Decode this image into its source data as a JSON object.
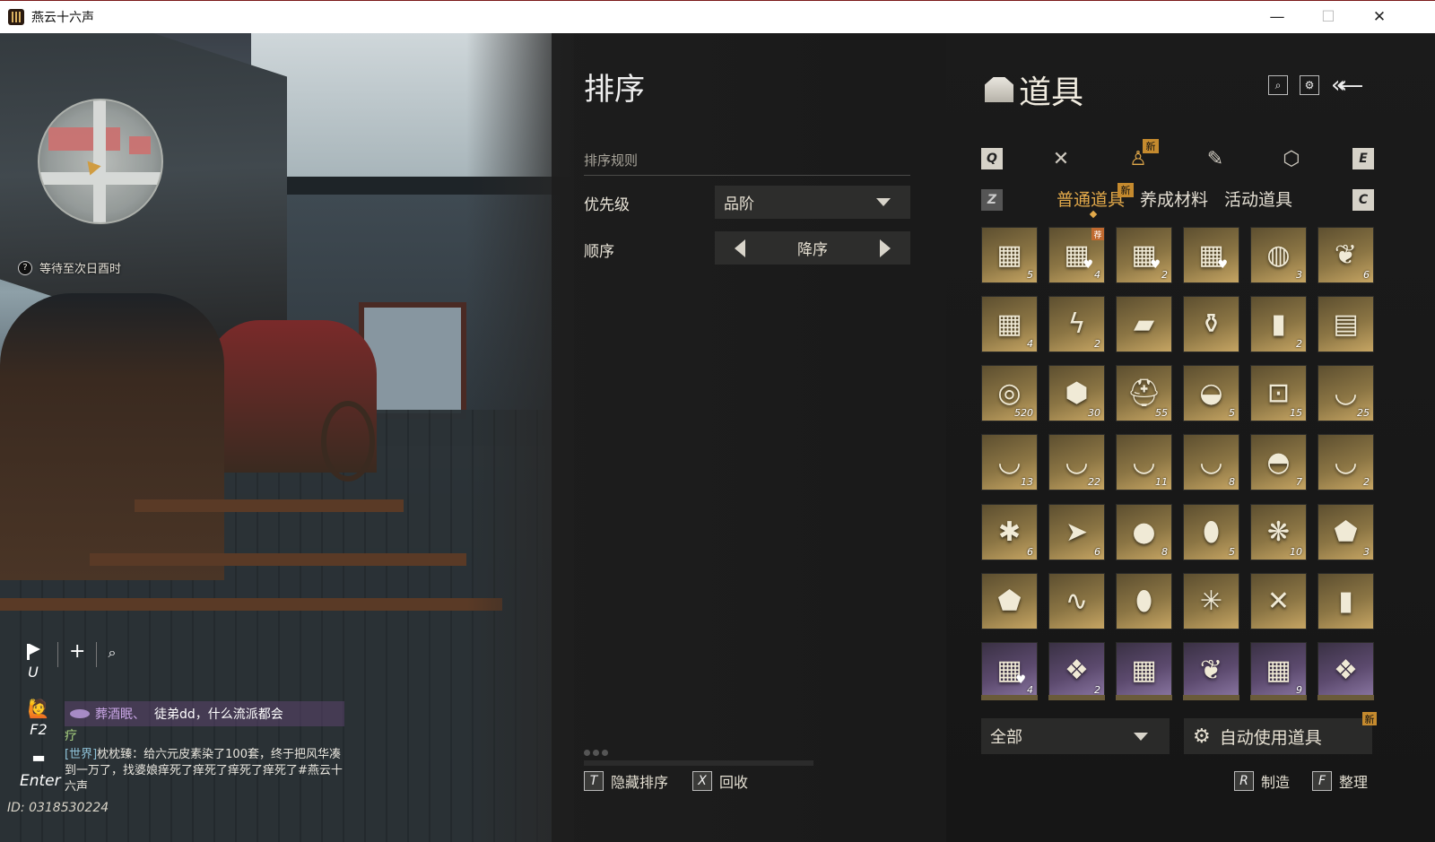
{
  "window": {
    "title": "燕云十六声",
    "controls": {
      "minimize": "—",
      "maximize": "☐",
      "close": "✕"
    }
  },
  "hud": {
    "wait_text": "等待至次日酉时",
    "wait_icon_glyph": "?",
    "map_key": "U",
    "add_glyph": "+",
    "search_glyph": "⌕",
    "chat": {
      "emote_key": "F2",
      "chat_key": "Enter",
      "msg1_name": "葬酒眠、",
      "msg1_text": "徒弟dd，什么流派都会",
      "msg1_cont": "疗",
      "world_tag": "[世界]",
      "world_text": "枕枕臻：给六元皮素染了100套，终于把风华凑到一万了，找婆娘痒死了痒死了痒死了痒死了#燕云十六声"
    },
    "id_text": "ID: 0318530224"
  },
  "sort": {
    "title": "排序",
    "rule_header": "排序规则",
    "priority_label": "优先级",
    "priority_value": "品阶",
    "order_label": "顺序",
    "order_value": "降序",
    "hint_hide_key": "T",
    "hint_hide": "隐藏排序",
    "hint_recycle_key": "X",
    "hint_recycle": "回收"
  },
  "inventory": {
    "title": "道具",
    "key_left": "Q",
    "key_right": "E",
    "sub_key_left": "Z",
    "sub_key_right": "C",
    "new_badge": "新",
    "subtabs": [
      "普通道具",
      "养成材料",
      "活动道具"
    ],
    "active_subtab": 0,
    "category_icons": [
      "crossed-swords-icon",
      "bell-icon",
      "scroll-icon",
      "badge-icon"
    ],
    "active_category": 1,
    "items": [
      {
        "name": "chest",
        "glyph": "▦",
        "count": "5",
        "tone": "gold"
      },
      {
        "name": "chest-heart-tagged",
        "glyph": "▦",
        "count": "4",
        "tone": "gold",
        "heart": true,
        "tag": "荐"
      },
      {
        "name": "chest-heart",
        "glyph": "▦",
        "count": "2",
        "tone": "gold",
        "heart": true
      },
      {
        "name": "chest-heart",
        "glyph": "▦",
        "count": "",
        "tone": "gold",
        "heart": true
      },
      {
        "name": "shell-chest",
        "glyph": "◍",
        "count": "3",
        "tone": "gold"
      },
      {
        "name": "leaf-chest",
        "glyph": "❦",
        "count": "6",
        "tone": "gold"
      },
      {
        "name": "dark-chest",
        "glyph": "▦",
        "count": "4",
        "tone": "gold"
      },
      {
        "name": "lightning-shard",
        "glyph": "ϟ",
        "count": "2",
        "tone": "gold"
      },
      {
        "name": "ink-stone",
        "glyph": "▰",
        "count": "",
        "tone": "gold"
      },
      {
        "name": "porcelain-vase",
        "glyph": "⚱",
        "count": "",
        "tone": "gold"
      },
      {
        "name": "red-book",
        "glyph": "▮",
        "count": "2",
        "tone": "gold"
      },
      {
        "name": "open-book",
        "glyph": "▤",
        "count": "",
        "tone": "gold"
      },
      {
        "name": "jade-ring",
        "glyph": "◎",
        "count": "520",
        "tone": "gold"
      },
      {
        "name": "tablet",
        "glyph": "⬢",
        "count": "30",
        "tone": "gold"
      },
      {
        "name": "bronze-helm",
        "glyph": "⛑",
        "count": "55",
        "tone": "gold"
      },
      {
        "name": "gold-ingot",
        "glyph": "◒",
        "count": "5",
        "tone": "gold"
      },
      {
        "name": "coin",
        "glyph": "⊡",
        "count": "15",
        "tone": "gold"
      },
      {
        "name": "bowl",
        "glyph": "◡",
        "count": "25",
        "tone": "gold"
      },
      {
        "name": "bowl",
        "glyph": "◡",
        "count": "13",
        "tone": "gold"
      },
      {
        "name": "bowl",
        "glyph": "◡",
        "count": "22",
        "tone": "gold"
      },
      {
        "name": "bowl-rooster",
        "glyph": "◡",
        "count": "11",
        "tone": "gold"
      },
      {
        "name": "bowl",
        "glyph": "◡",
        "count": "8",
        "tone": "gold"
      },
      {
        "name": "lidded-bowl",
        "glyph": "◓",
        "count": "7",
        "tone": "gold"
      },
      {
        "name": "bowl",
        "glyph": "◡",
        "count": "2",
        "tone": "gold"
      },
      {
        "name": "bee",
        "glyph": "✱",
        "count": "6",
        "tone": "gold"
      },
      {
        "name": "fish",
        "glyph": "➤",
        "count": "6",
        "tone": "gold"
      },
      {
        "name": "orange-fruit",
        "glyph": "●",
        "count": "8",
        "tone": "gold"
      },
      {
        "name": "dark-beetle",
        "glyph": "⬮",
        "count": "5",
        "tone": "gold"
      },
      {
        "name": "green-cicada",
        "glyph": "❋",
        "count": "10",
        "tone": "gold"
      },
      {
        "name": "stone",
        "glyph": "⬟",
        "count": "3",
        "tone": "gold"
      },
      {
        "name": "blue-ore",
        "glyph": "⬟",
        "count": "",
        "tone": "gold"
      },
      {
        "name": "chain",
        "glyph": "∿",
        "count": "",
        "tone": "gold"
      },
      {
        "name": "egg-stone",
        "glyph": "⬮",
        "count": "",
        "tone": "gold"
      },
      {
        "name": "grasshopper",
        "glyph": "✳",
        "count": "",
        "tone": "gold"
      },
      {
        "name": "dragonfly",
        "glyph": "✕",
        "count": "",
        "tone": "gold"
      },
      {
        "name": "blue-card",
        "glyph": "▮",
        "count": "",
        "tone": "gold"
      },
      {
        "name": "purple-chest-heart",
        "glyph": "▦",
        "count": "4",
        "tone": "purple",
        "heart": true
      },
      {
        "name": "blue-pouch",
        "glyph": "❖",
        "count": "2",
        "tone": "purple"
      },
      {
        "name": "purple-chest",
        "glyph": "▦",
        "count": "",
        "tone": "purple"
      },
      {
        "name": "plant-chest",
        "glyph": "❦",
        "count": "",
        "tone": "purple"
      },
      {
        "name": "purple-chest",
        "glyph": "▦",
        "count": "9",
        "tone": "purple"
      },
      {
        "name": "gift-box",
        "glyph": "❖",
        "count": "",
        "tone": "purple"
      }
    ],
    "filter_value": "全部",
    "auto_use_label": "自动使用道具",
    "hint_craft_key": "R",
    "hint_craft": "制造",
    "hint_sort_key": "F",
    "hint_sort": "整理"
  },
  "colors": {
    "accent": "#e2a94a",
    "slot_gold": "#8b7544",
    "slot_purple": "#5c4a6e"
  }
}
